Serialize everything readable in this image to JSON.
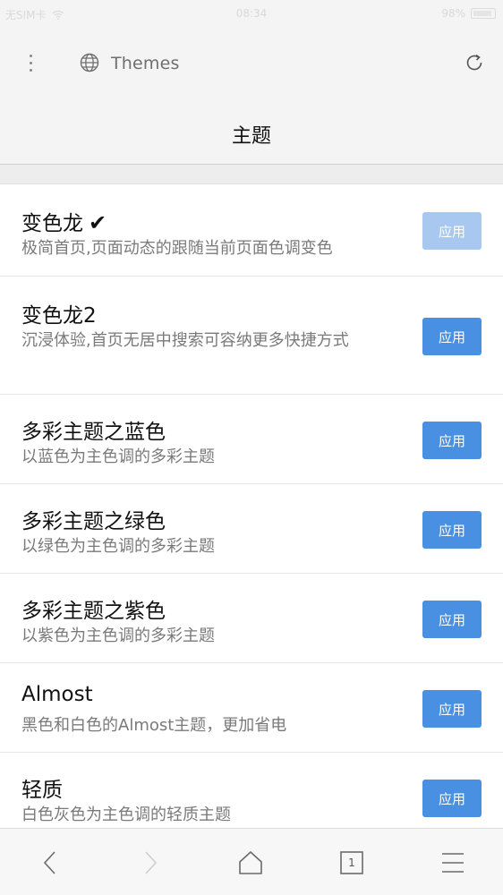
{
  "status_bar": {
    "carrier": "无SIM卡",
    "time": "08:34",
    "battery": "98%"
  },
  "toolbar": {
    "page_name": "Themes",
    "menu_icon": "more-vertical-icon",
    "site_icon": "globe-icon",
    "refresh_icon": "refresh-icon"
  },
  "header": {
    "title": "主题"
  },
  "themes": [
    {
      "name": "变色龙",
      "selected": true,
      "desc": "极简首页,页面动态的跟随当前页面色调变色",
      "button": "应用"
    },
    {
      "name": "变色龙2",
      "selected": false,
      "desc": "沉浸体验,首页无居中搜索可容纳更多快捷方式",
      "button": "应用"
    },
    {
      "name": "多彩主题之蓝色",
      "selected": false,
      "desc": "以蓝色为主色调的多彩主题",
      "button": "应用"
    },
    {
      "name": "多彩主题之绿色",
      "selected": false,
      "desc": "以绿色为主色调的多彩主题",
      "button": "应用"
    },
    {
      "name": "多彩主题之紫色",
      "selected": false,
      "desc": "以紫色为主色调的多彩主题",
      "button": "应用"
    },
    {
      "name": "Almost",
      "selected": false,
      "desc": "黑色和白色的Almost主题，更加省电",
      "button": "应用"
    },
    {
      "name": "轻质",
      "selected": false,
      "desc": "白色灰色为主色调的轻质主题",
      "button": "应用"
    }
  ],
  "selected_mark": "✔",
  "bottom_nav": {
    "back_icon": "chevron-left-icon",
    "forward_icon": "chevron-right-icon",
    "home_icon": "home-icon",
    "tabs_icon": "tabs-icon",
    "tabs_count": "1",
    "menu_icon": "hamburger-menu-icon"
  },
  "colors": {
    "accent": "#4a90e2",
    "accent_disabled": "#a9c8ef",
    "bar_bg": "#f4f4f4"
  }
}
